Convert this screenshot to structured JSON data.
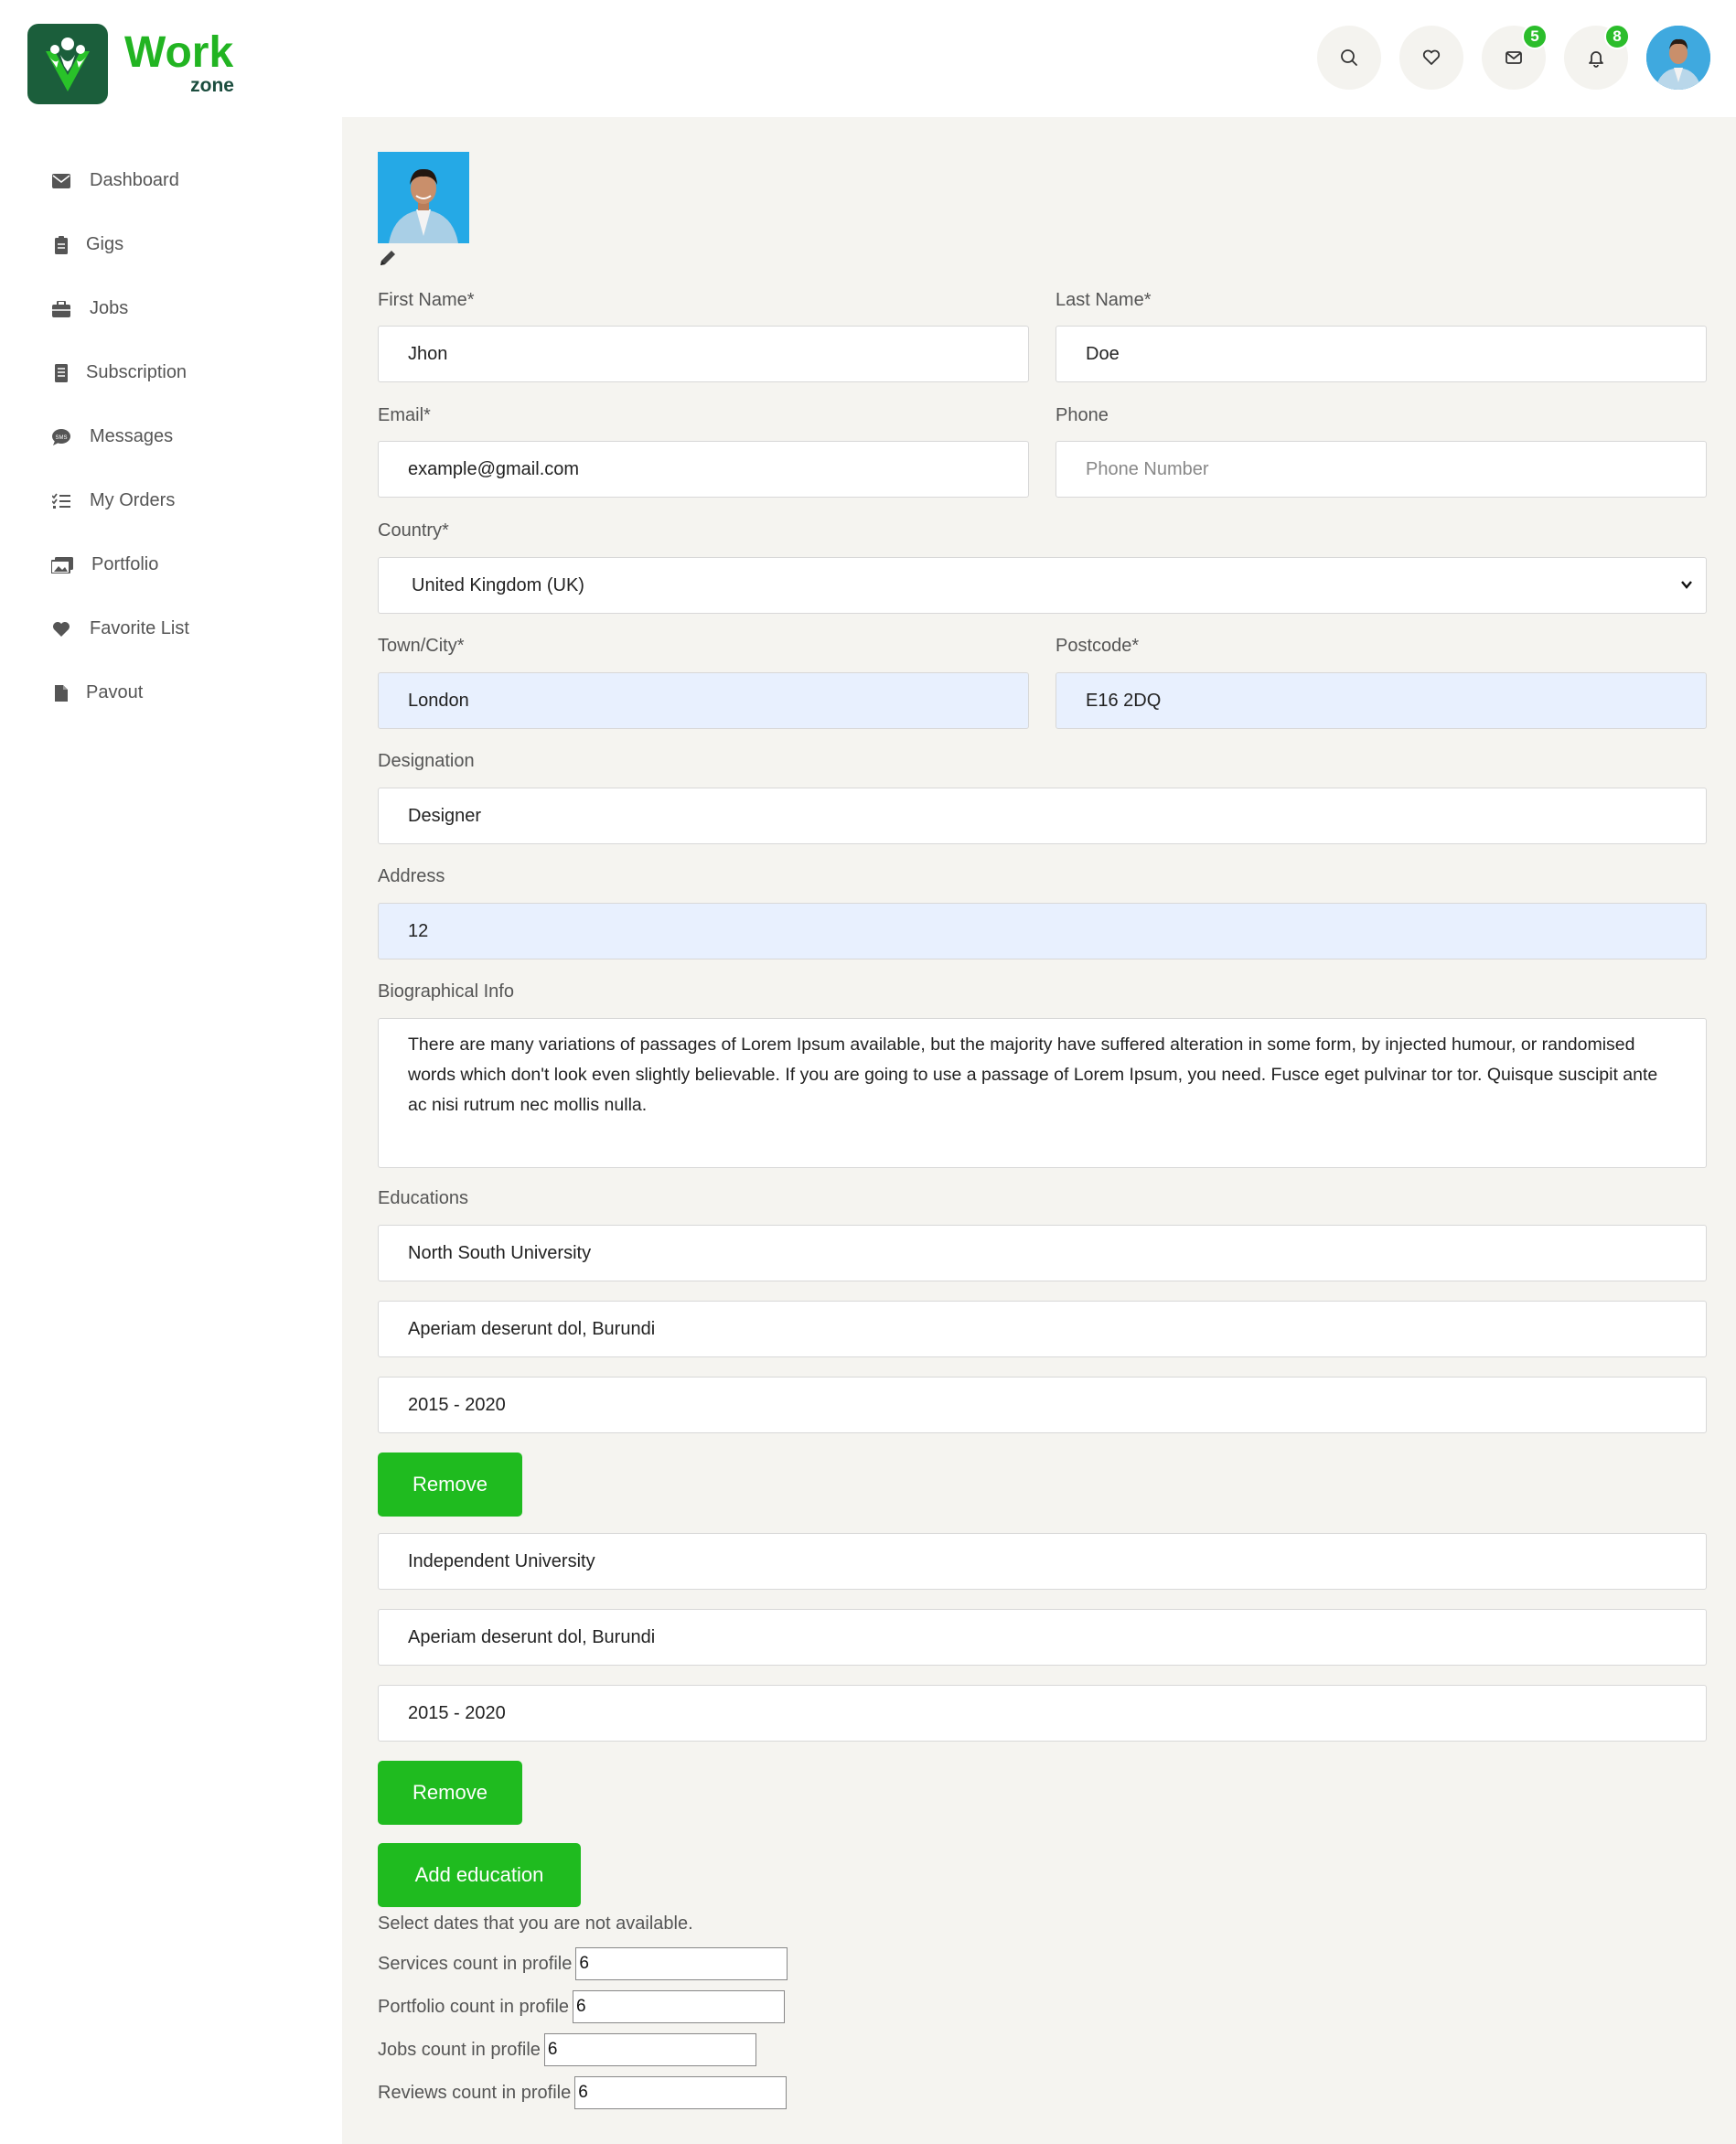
{
  "brand": {
    "word": "Work",
    "sub": "zone"
  },
  "header": {
    "icons": [
      "search-icon",
      "heart-icon",
      "envelope-icon",
      "bell-icon"
    ],
    "messages_badge": "5",
    "notifications_badge": "8"
  },
  "sidebar": {
    "items": [
      {
        "label": "Dashboard",
        "icon": "envelope-icon"
      },
      {
        "label": "Gigs",
        "icon": "clipboard-icon"
      },
      {
        "label": "Jobs",
        "icon": "briefcase-icon"
      },
      {
        "label": "Subscription",
        "icon": "receipt-icon"
      },
      {
        "label": "Messages",
        "icon": "sms-icon"
      },
      {
        "label": "My Orders",
        "icon": "list-check-icon"
      },
      {
        "label": "Portfolio",
        "icon": "images-icon"
      },
      {
        "label": "Favorite List",
        "icon": "heart-icon"
      },
      {
        "label": "Pavout",
        "icon": "file-icon"
      }
    ]
  },
  "form": {
    "first_name_label": "First Name*",
    "first_name": "Jhon",
    "last_name_label": "Last Name*",
    "last_name": "Doe",
    "email_label": "Email*",
    "email": "example@gmail.com",
    "phone_label": "Phone",
    "phone_placeholder": "Phone Number",
    "country_label": "Country*",
    "country": "United Kingdom (UK)",
    "town_label": "Town/City*",
    "town": "London",
    "postcode_label": "Postcode*",
    "postcode": "E16 2DQ",
    "designation_label": "Designation",
    "designation": "Designer",
    "address_label": "Address",
    "address": "12",
    "bio_label": "Biographical Info",
    "bio": "There are many variations of passages of Lorem Ipsum available, but the majority have suffered alteration in some form, by injected humour, or randomised words which don't look even slightly believable. If you are going to use a passage of Lorem Ipsum, you need. Fusce eget pulvinar tor tor. Quisque suscipit ante ac nisi rutrum nec mollis nulla.",
    "educations_label": "Educations",
    "educations": [
      {
        "school": "North South University",
        "location": "Aperiam deserunt dol, Burundi",
        "years": "2015 - 2020",
        "remove": "Remove"
      },
      {
        "school": "Independent University",
        "location": "Aperiam deserunt dol, Burundi",
        "years": "2015 - 2020",
        "remove": "Remove"
      }
    ],
    "add_education": "Add education",
    "dates_note": "Select dates that you are not available.",
    "counts": [
      {
        "label": "Services count in profile",
        "value": "6"
      },
      {
        "label": "Portfolio count in profile",
        "value": "6"
      },
      {
        "label": "Jobs count in profile",
        "value": "6"
      },
      {
        "label": "Reviews count in profile",
        "value": "6"
      }
    ]
  }
}
